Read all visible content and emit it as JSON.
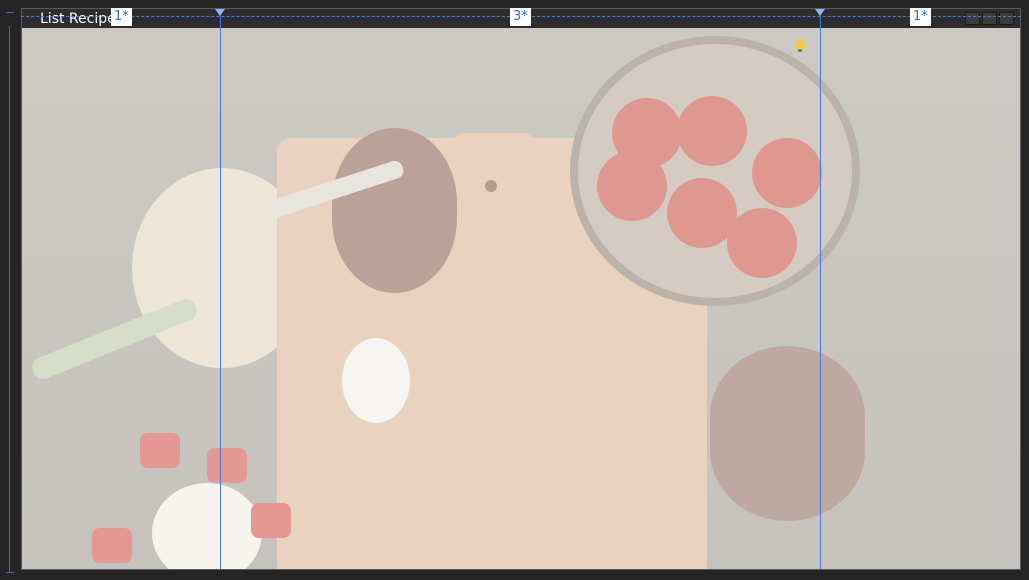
{
  "window": {
    "title": "List Recipe"
  },
  "grid": {
    "columns": [
      {
        "label": "1*"
      },
      {
        "label": "3*"
      },
      {
        "label": "1*"
      }
    ]
  },
  "icons": {
    "bulb": "lightbulb-icon"
  },
  "colors": {
    "guide": "#4a7bdc",
    "label_text": "#2f6fdc",
    "chrome": "#252526"
  }
}
